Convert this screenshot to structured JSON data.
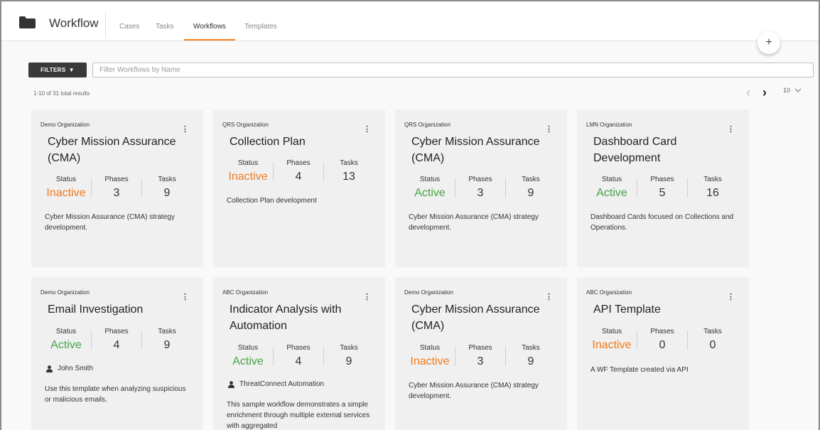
{
  "app": {
    "title": "Workflow"
  },
  "tabs": [
    {
      "label": "Cases"
    },
    {
      "label": "Tasks"
    },
    {
      "label": "Workflows"
    },
    {
      "label": "Templates"
    }
  ],
  "add_button": {
    "label": "+"
  },
  "filters": {
    "button_label": "FILTERS",
    "placeholder": "Filter Workflows by Name"
  },
  "results_text": "1-10 of 31 total results",
  "pagination": {
    "prev": "‹",
    "next": "›",
    "per_page": "10"
  },
  "stat_labels": {
    "status": "Status",
    "phases": "Phases",
    "tasks": "Tasks"
  },
  "colors": {
    "accent": "#f58220",
    "active": "#46a346",
    "inactive": "#ee7a1f"
  },
  "cards": [
    {
      "org": "Demo Organization",
      "name": "Cyber Mission Assurance (CMA)",
      "status": "Inactive",
      "phases": "3",
      "tasks": "9",
      "owner": "",
      "description": "Cyber Mission Assurance (CMA) strategy development."
    },
    {
      "org": "QRS Organization",
      "name": "Collection Plan",
      "status": "Inactive",
      "phases": "4",
      "tasks": "13",
      "owner": "",
      "description": "Collection Plan development"
    },
    {
      "org": "QRS Organization",
      "name": "Cyber Mission Assurance (CMA)",
      "status": "Active",
      "phases": "3",
      "tasks": "9",
      "owner": "",
      "description": "Cyber Mission Assurance (CMA) strategy development."
    },
    {
      "org": "LMN Organization",
      "name": "Dashboard Card Development",
      "status": "Active",
      "phases": "5",
      "tasks": "16",
      "owner": "",
      "description": "Dashboard Cards focused on Collections and Operations."
    },
    {
      "org": "Demo Organization",
      "name": "Email Investigation",
      "status": "Active",
      "phases": "4",
      "tasks": "9",
      "owner": "John Smith",
      "description": "Use this template when analyzing suspicious or malicious emails."
    },
    {
      "org": "ABC Organization",
      "name": "Indicator Analysis with Automation",
      "status": "Active",
      "phases": "4",
      "tasks": "9",
      "owner": "ThreatConnect Automation",
      "description": "This sample workflow demonstrates a simple enrichment through multiple external services with aggregated"
    },
    {
      "org": "Demo Organization",
      "name": "Cyber Mission Assurance (CMA)",
      "status": "Inactive",
      "phases": "3",
      "tasks": "9",
      "owner": "",
      "description": "Cyber Mission Assurance (CMA) strategy development."
    },
    {
      "org": "ABC Organization",
      "name": "API Template",
      "status": "Inactive",
      "phases": "0",
      "tasks": "0",
      "owner": "",
      "description": "A WF Template created via API"
    }
  ]
}
